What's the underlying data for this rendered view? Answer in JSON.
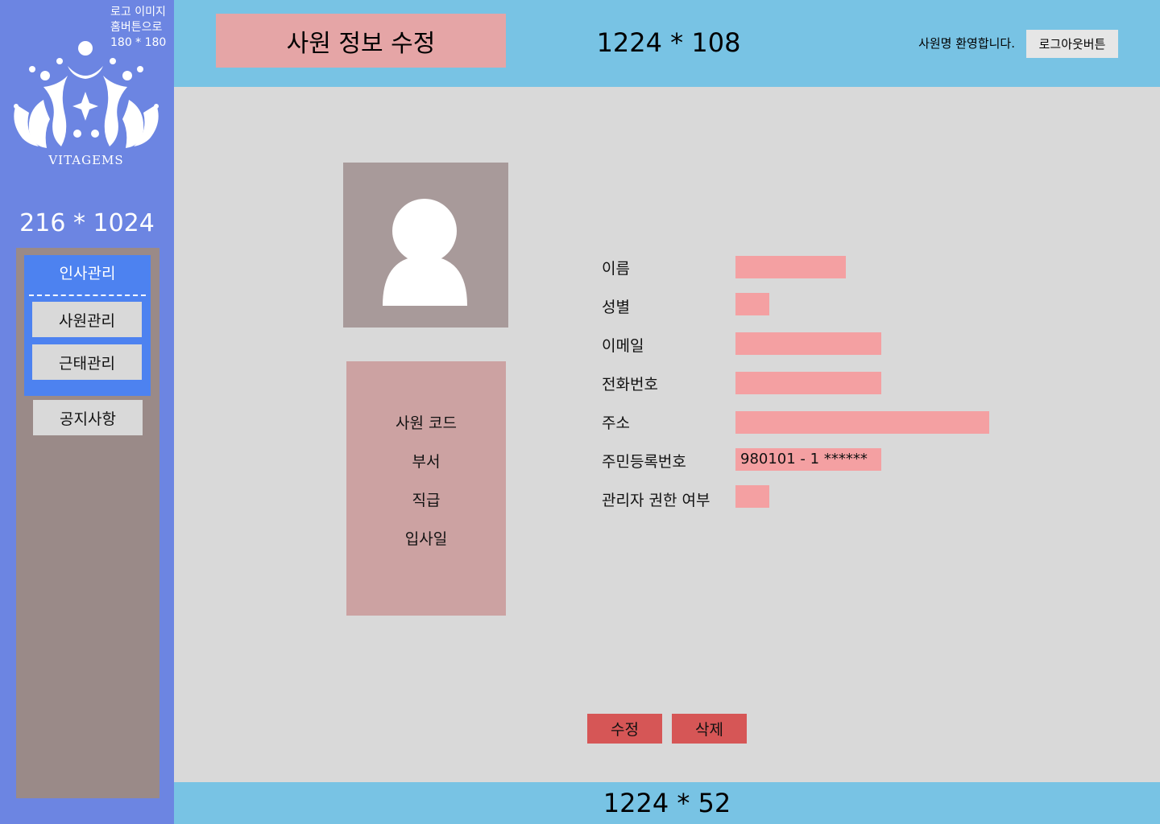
{
  "sidebar": {
    "logo_note_lines": [
      "로고 이미지",
      "홈버튼으로",
      "180 * 180"
    ],
    "logo_text": "VITAGEMS",
    "dimension_label": "216 * 1024",
    "menu_group": {
      "title": "인사관리",
      "items": [
        {
          "label": "사원관리"
        },
        {
          "label": "근태관리"
        }
      ]
    },
    "notice_label": "공지사항"
  },
  "header": {
    "page_title": "사원 정보 수정",
    "dimension_label": "1224 * 108",
    "welcome_text": "사원명 환영합니다.",
    "logout_label": "로그아웃버튼"
  },
  "main": {
    "avatar_icon": "user-silhouette-icon",
    "info_card": {
      "items": [
        "사원 코드",
        "부서",
        "직급",
        "입사일"
      ]
    },
    "fields": [
      {
        "label": "이름",
        "value": ""
      },
      {
        "label": "성별",
        "value": ""
      },
      {
        "label": "이메일",
        "value": ""
      },
      {
        "label": "전화번호",
        "value": ""
      },
      {
        "label": "주소",
        "value": ""
      },
      {
        "label": "주민등록번호",
        "value": "980101 - 1 ******"
      },
      {
        "label": "관리자 권한 여부",
        "value": ""
      }
    ],
    "actions": {
      "edit_label": "수정",
      "delete_label": "삭제"
    }
  },
  "footer": {
    "dimension_label": "1224 * 52"
  },
  "colors": {
    "sidebar_bg": "#6c85e2",
    "header_bg": "#78c3e4",
    "content_bg": "#d9d9d9",
    "title_box": "#e5a5a6",
    "field_bar": "#f4a0a2",
    "action_button": "#d65656"
  }
}
